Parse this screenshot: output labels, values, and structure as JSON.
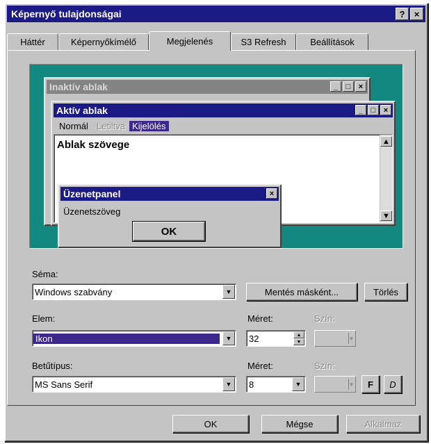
{
  "window": {
    "title": "Képernyő tulajdonságai",
    "help_glyph": "?",
    "close_glyph": "×"
  },
  "tabs": [
    {
      "label": "Háttér"
    },
    {
      "label": "Képernyőkímélő"
    },
    {
      "label": "Megjelenés",
      "active": true
    },
    {
      "label": "S3 Refresh"
    },
    {
      "label": "Beállítások"
    }
  ],
  "preview": {
    "inactive_title": "Inaktív ablak",
    "active_title": "Aktív ablak",
    "menu": {
      "normal": "Normál",
      "disabled": "Letiltva",
      "selected": "Kijelölés"
    },
    "window_text": "Ablak szövege",
    "msgbox_title": "Üzenetpanel",
    "msgbox_text": "Üzenetszöveg",
    "msgbox_ok": "OK",
    "btn_min": "_",
    "btn_max": "□",
    "btn_close": "×"
  },
  "scheme": {
    "label": "Séma:",
    "value": "Windows szabvány",
    "save_as": "Mentés másként...",
    "delete": "Törlés"
  },
  "item": {
    "label": "Elem:",
    "value": "Ikon",
    "size_label": "Méret:",
    "size_value": "32",
    "color_label": "Szín:"
  },
  "font": {
    "label": "Betűtípus:",
    "value": "MS Sans Serif",
    "size_label": "Méret:",
    "size_value": "8",
    "color_label": "Szín:",
    "bold": "F",
    "italic": "D"
  },
  "footer": {
    "ok": "OK",
    "cancel": "Mégse",
    "apply": "Alkalmaz"
  },
  "colors": {
    "active_title": "#1c1a84",
    "inactive_title": "#848484",
    "desktop": "#14877e",
    "highlight": "#3b2a8c"
  }
}
